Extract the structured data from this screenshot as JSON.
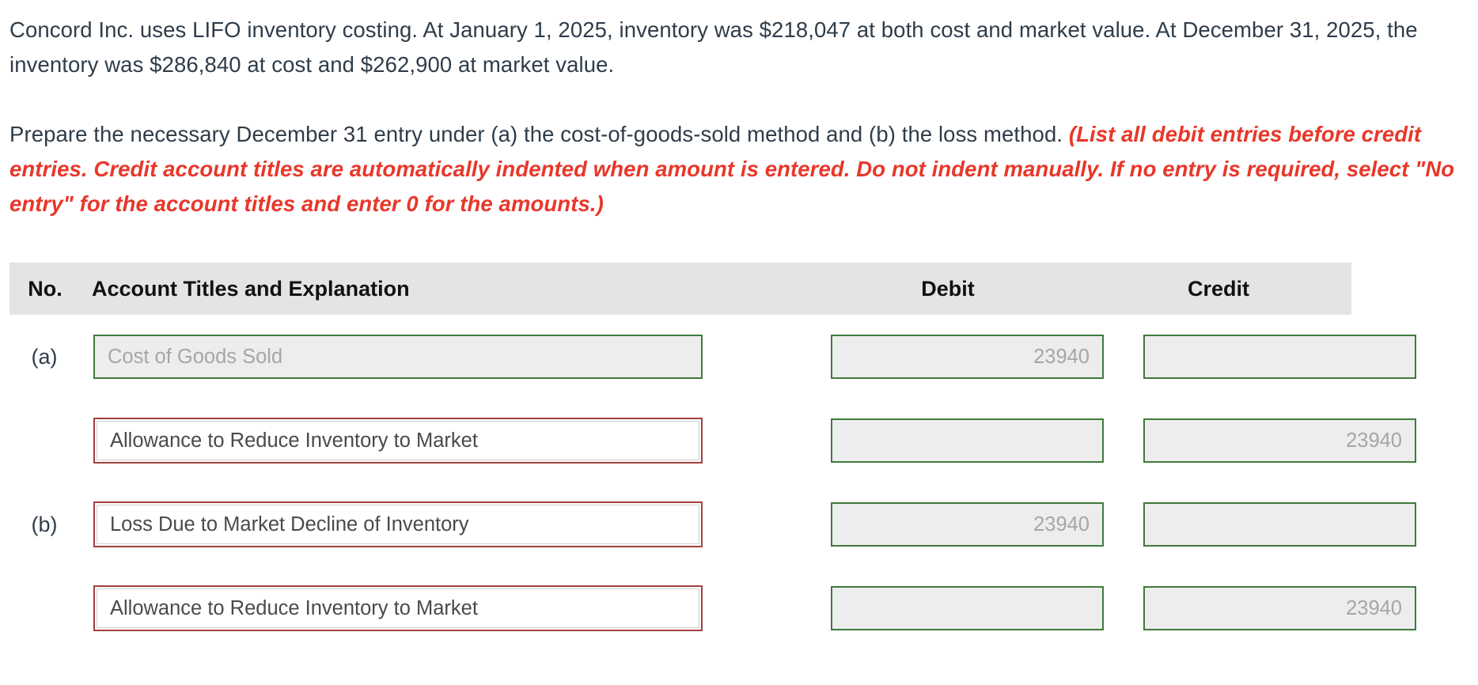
{
  "problem": {
    "paragraph_1": "Concord Inc. uses LIFO inventory costing. At January 1, 2025, inventory was $218,047 at both cost and market value. At December 31, 2025, the inventory was $286,840 at cost and $262,900 at market value.",
    "paragraph_2_lead": "Prepare the necessary December 31 entry under (a) the cost-of-goods-sold method and (b) the loss method. ",
    "paragraph_2_hint": "(List all debit entries before credit entries. Credit account titles are automatically indented when amount is entered. Do not indent manually. If no entry is required, select \"No entry\" for the account titles and enter 0 for the amounts.)"
  },
  "table": {
    "headers": {
      "no": "No.",
      "account": "Account Titles and Explanation",
      "debit": "Debit",
      "credit": "Credit"
    },
    "rows": [
      {
        "no": "(a)",
        "account": "Cost of Goods Sold",
        "account_state": "locked",
        "indented": false,
        "debit": "23940",
        "credit": ""
      },
      {
        "no": "",
        "account": "Allowance to Reduce Inventory to Market",
        "account_state": "active",
        "indented": true,
        "debit": "",
        "credit": "23940"
      },
      {
        "no": "(b)",
        "account": "Loss Due to Market Decline of Inventory",
        "account_state": "active",
        "indented": false,
        "debit": "23940",
        "credit": ""
      },
      {
        "no": "",
        "account": "Allowance to Reduce Inventory to Market",
        "account_state": "active",
        "indented": true,
        "debit": "",
        "credit": "23940"
      }
    ]
  },
  "colors": {
    "hint_red": "#e8372a",
    "field_border_green": "#3f7a3c",
    "field_border_red": "#a04040",
    "header_bg": "#e4e4e4",
    "text": "#2f3c4a"
  }
}
